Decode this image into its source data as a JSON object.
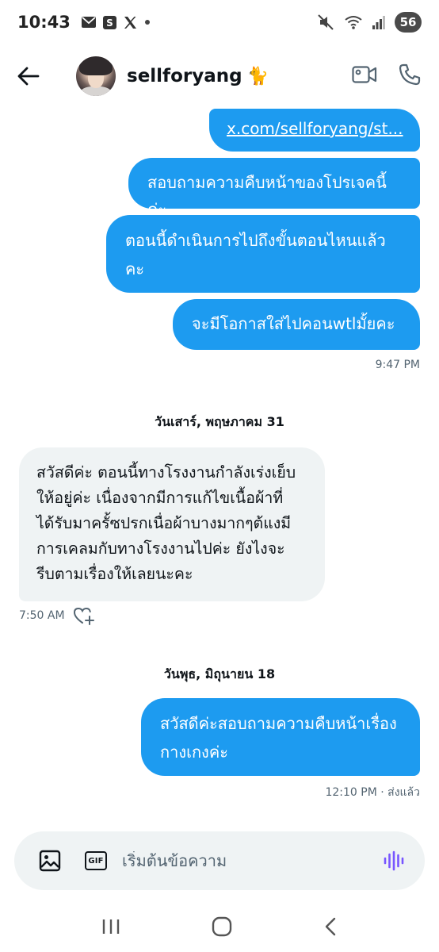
{
  "status_bar": {
    "time": "10:43",
    "battery": "56"
  },
  "header": {
    "contact_name": "sellforyang",
    "contact_emoji": "🐈"
  },
  "messages": {
    "m1": "x.com/sellforyang/st...",
    "m2": "สอบถามความคืบหน้าของโปรเจคนี้ค่ะ",
    "m3_line1": "ตอนนี้ดำเนินการไปถึงขั้นตอนไหนแล้ว",
    "m3_line2": "คะ",
    "m4": "จะมีโอกาสใส่ไปคอนwtlมั้ยคะ",
    "m4_time": "9:47 PM",
    "date1": "วันเสาร์, พฤษภาคม 31",
    "m5_line1": "สวัสดีค่ะ ตอนนี้ทางโรงงานกำลังเร่งเย็บ",
    "m5_line2": "ให้อยู่ค่ะ เนื่องจากมีการแก้ไขเนื้อผ้าที่",
    "m5_line3": "ได้รับมาครั้ซปรกเนื่อผ้าบางมากๆต้แงมี",
    "m5_line4": "การเคลมกับทางโรงงานไปค่ะ ยังไงจะ",
    "m5_line5": "รีบตามเรื่องให้เลยนะคะ",
    "m5_time": "7:50 AM",
    "date2": "วันพุธ, มิถุนายน 18",
    "m6_line1": "สวัสดีค่ะสอบถามความคืบหน้าเรื่อง",
    "m6_line2": "กางเกงค่ะ",
    "m6_meta": "12:10 PM · ส่งแล้ว"
  },
  "composer": {
    "placeholder": "เริ่มต้นข้อความ"
  },
  "colors": {
    "accent": "#1d9bf0",
    "incoming_bg": "#eff3f4",
    "voice": "#7856ff"
  }
}
